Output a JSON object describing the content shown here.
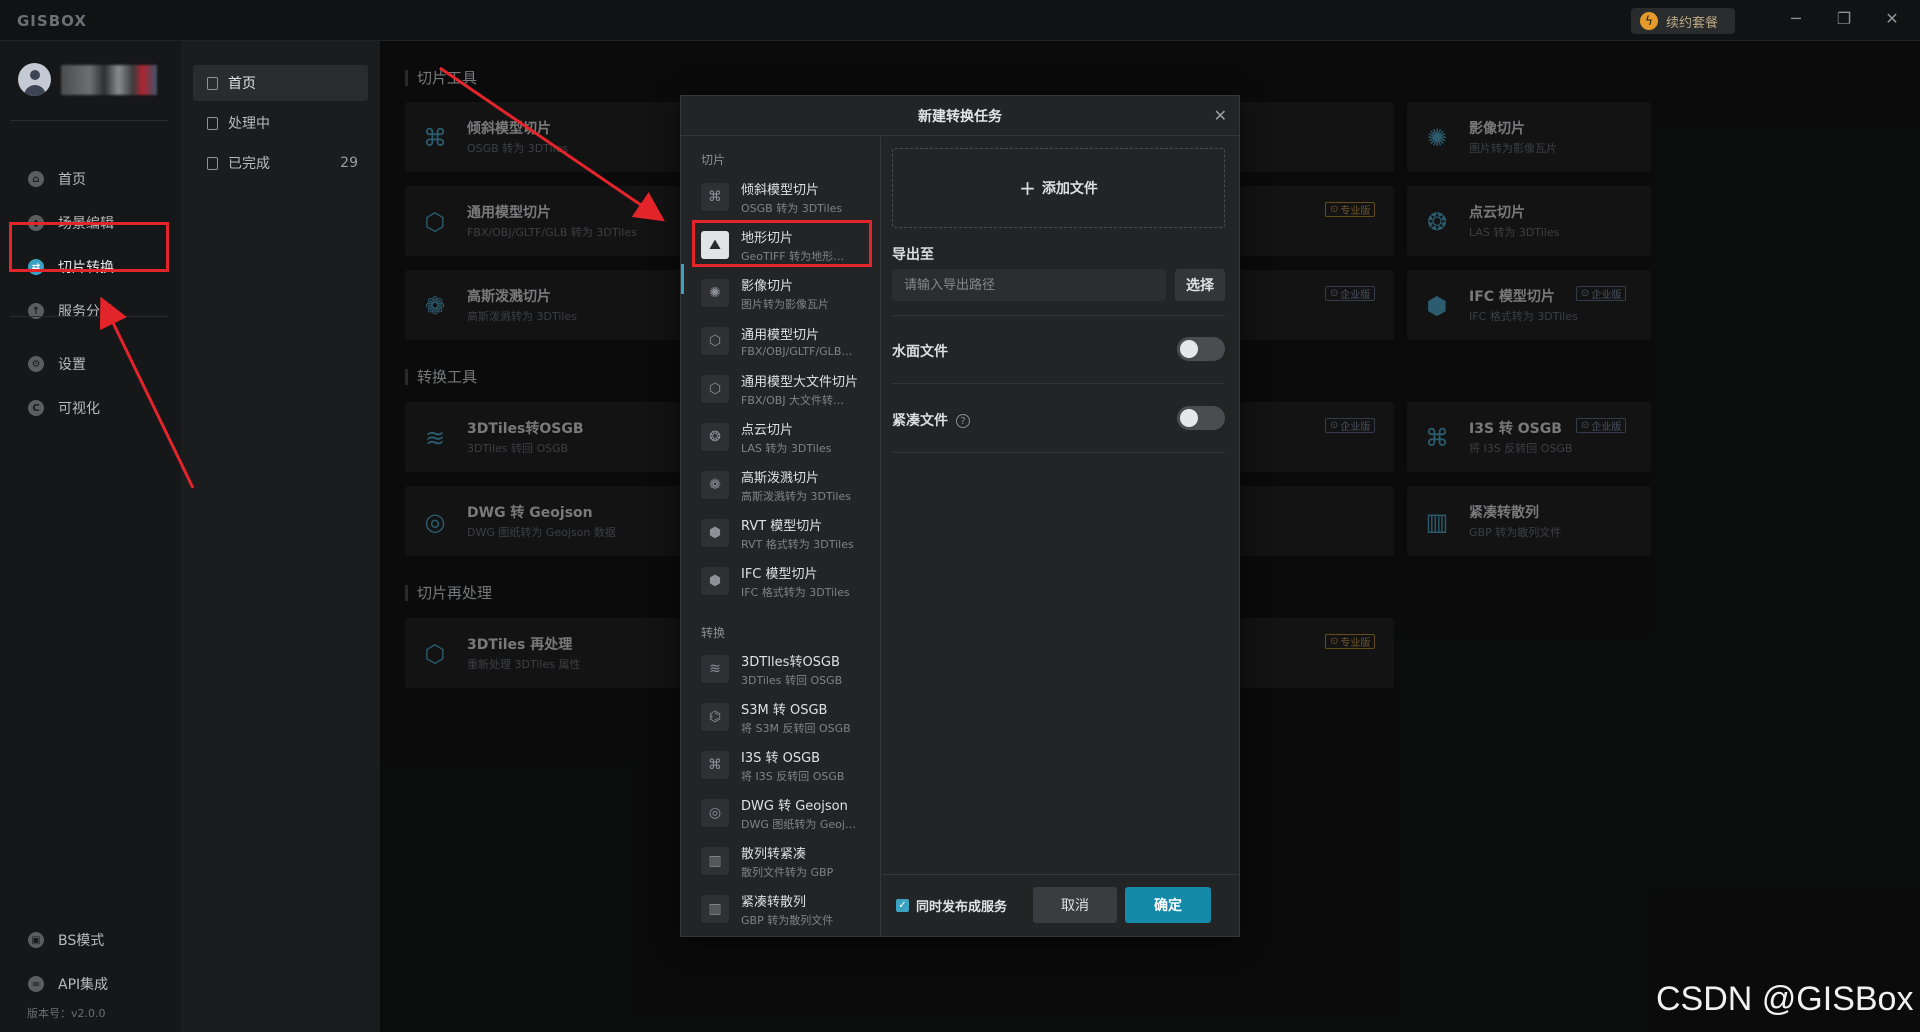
{
  "app": {
    "brand": "GISBOX",
    "renew_label": "续约套餐",
    "win_min": "─",
    "win_restore": "❐",
    "win_close": "✕"
  },
  "sidebar": {
    "items": [
      {
        "label": "首页",
        "icon": "home-icon"
      },
      {
        "label": "场景编辑",
        "icon": "cube-icon"
      },
      {
        "label": "切片转换",
        "icon": "convert-icon"
      },
      {
        "label": "服务分发",
        "icon": "upload-icon"
      },
      {
        "label": "设置",
        "icon": "gear-icon"
      },
      {
        "label": "可视化",
        "icon": "chart-icon"
      }
    ],
    "bottom": [
      {
        "label": "BS模式",
        "icon": "browser-icon"
      },
      {
        "label": "API集成",
        "icon": "link-icon"
      }
    ],
    "version": "版本号：v2.0.0"
  },
  "subnav": {
    "items": [
      {
        "label": "首页"
      },
      {
        "label": "处理中"
      },
      {
        "label": "已完成",
        "count": "29"
      }
    ]
  },
  "main": {
    "sections": [
      "切片工具",
      "转换工具",
      "切片再处理"
    ],
    "cards": [
      {
        "title": "倾斜模型切片",
        "sub": "OSGB 转为 3DTiles"
      },
      {
        "title": "影像切片",
        "sub": "图片转为影像瓦片"
      },
      {
        "title": "通用模型切片",
        "sub": "FBX/OBJ/GLTF/GLB 转为 3DTiles"
      },
      {
        "title": "点云切片",
        "sub": "LAS 转为 3DTiles"
      },
      {
        "title": "高斯泼溅切片",
        "sub": "高斯泼溅转为 3DTiles"
      },
      {
        "title": "IFC 模型切片",
        "sub": "IFC 格式转为 3DTiles"
      },
      {
        "title": "3DTiles转OSGB",
        "sub": "3DTiles 转回 OSGB"
      },
      {
        "title": "I3S 转 OSGB",
        "sub": "将 I3S 反转回 OSGB"
      },
      {
        "title": "DWG 转 Geojson",
        "sub": "DWG 图纸转为 Geojson 数据"
      },
      {
        "title": "紧凑转散列",
        "sub": "GBP 转为散列文件"
      },
      {
        "title": "3DTiles 再处理",
        "sub": "重新处理 3DTiles 属性"
      }
    ],
    "badges": {
      "pro": "专业版",
      "ent": "企业版"
    }
  },
  "modal": {
    "title": "新建转换任务",
    "group_slice": "切片",
    "group_convert": "转换",
    "items": [
      {
        "title": "倾斜模型切片",
        "sub": "OSGB 转为 3DTiles"
      },
      {
        "title": "地形切片",
        "sub": "GeoTIFF 转为地形…"
      },
      {
        "title": "影像切片",
        "sub": "图片转为影像瓦片"
      },
      {
        "title": "通用模型切片",
        "sub": "FBX/OBJ/GLTF/GLB…"
      },
      {
        "title": "通用模型大文件切片",
        "sub": "FBX/OBJ 大文件转…"
      },
      {
        "title": "点云切片",
        "sub": "LAS 转为 3DTiles"
      },
      {
        "title": "高斯泼溅切片",
        "sub": "高斯泼溅转为 3DTiles"
      },
      {
        "title": "RVT 模型切片",
        "sub": "RVT 格式转为 3DTiles"
      },
      {
        "title": "IFC 模型切片",
        "sub": "IFC 格式转为 3DTiles"
      },
      {
        "title": "3DTIles转OSGB",
        "sub": "3DTiles 转回 OSGB"
      },
      {
        "title": "S3M 转 OSGB",
        "sub": "将 S3M 反转回 OSGB"
      },
      {
        "title": "I3S 转 OSGB",
        "sub": "将 I3S 反转回 OSGB"
      },
      {
        "title": "DWG 转 Geojson",
        "sub": "DWG 图纸转为 Geoj…"
      },
      {
        "title": "散列转紧凑",
        "sub": "散列文件转为 GBP"
      },
      {
        "title": "紧凑转散列",
        "sub": "GBP 转为散列文件"
      }
    ],
    "add_file": "添加文件",
    "export_label": "导出至",
    "export_placeholder": "请输入导出路径",
    "select_label": "选择",
    "water_label": "水面文件",
    "compact_label": "紧凑文件",
    "publish_label": "同时发布成服务",
    "cancel_label": "取消",
    "ok_label": "确定"
  },
  "watermark": "CSDN @GISBox"
}
